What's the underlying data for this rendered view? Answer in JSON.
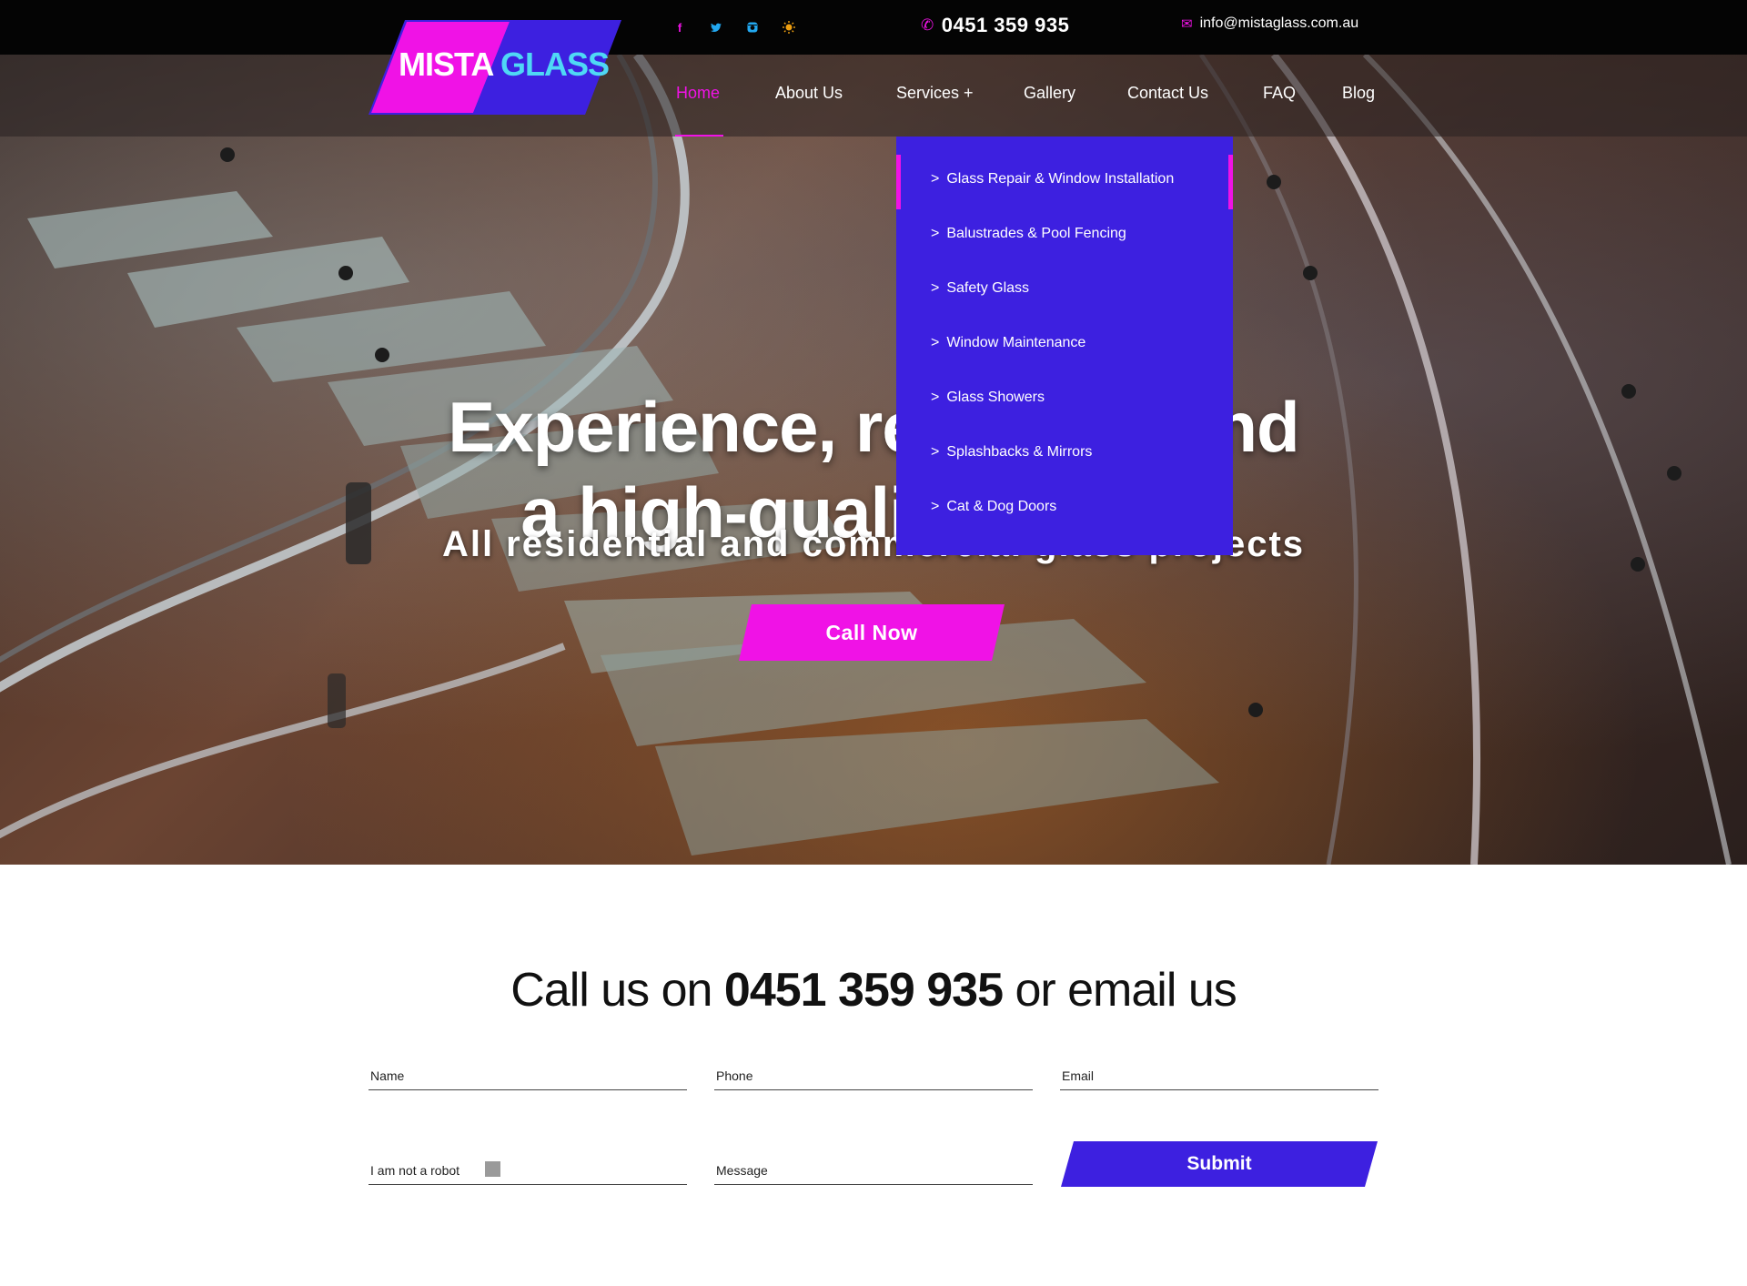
{
  "brand": {
    "logo_word1": "MISTA",
    "logo_word2": "GLASS",
    "colors": {
      "magenta": "#f012e6",
      "blue": "#3d20e0",
      "cyan": "#4fd8f5"
    }
  },
  "topbar": {
    "social": [
      {
        "icon": "facebook-icon",
        "glyph": "f",
        "color": "#f012e6"
      },
      {
        "icon": "twitter-icon",
        "glyph": "t",
        "color": "#22a8f0"
      },
      {
        "icon": "instagram-icon",
        "glyph": "▣",
        "color": "#22a8f0"
      },
      {
        "icon": "yelp-icon",
        "glyph": "✹",
        "color": "#f0a010"
      }
    ],
    "phone": "0451 359 935",
    "email": "info@mistaglass.com.au"
  },
  "nav": {
    "home": "Home",
    "about": "About Us",
    "services": "Services +",
    "gallery": "Gallery",
    "contact": "Contact Us",
    "faq": "FAQ",
    "blog": "Blog"
  },
  "services_menu": [
    "Glass Repair & Window Installation",
    "Balustrades & Pool Fencing",
    "Safety Glass",
    "Window Maintenance",
    "Glass Showers",
    "Splashbacks & Mirrors",
    "Cat & Dog Doors"
  ],
  "services_menu_arrow": ">",
  "hero": {
    "title_line1": "Experience, reliability and",
    "title_line2": "a high-quality service",
    "subtitle": "All residential and commercial glass projects",
    "cta": "Call Now"
  },
  "contact": {
    "heading_pre": "Call us on",
    "heading_phone": "0451 359 935",
    "heading_post": "or email us",
    "name_placeholder": "Name",
    "phone_placeholder": "Phone",
    "email_placeholder": "Email",
    "robot_label": "I am not a robot",
    "message_placeholder": "Message",
    "submit": "Submit"
  }
}
